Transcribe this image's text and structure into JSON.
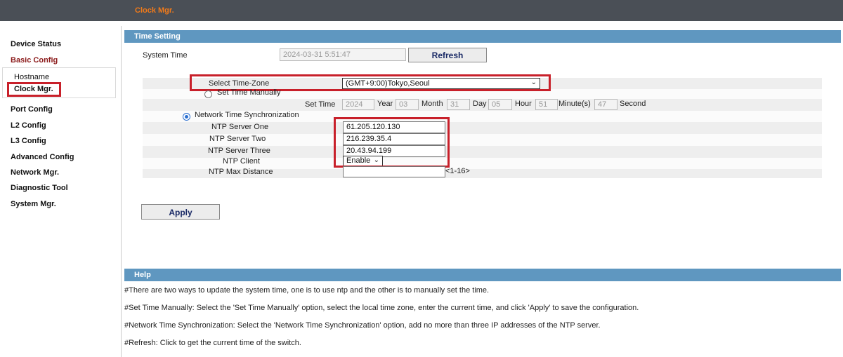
{
  "header": {
    "breadcrumb": "Clock Mgr."
  },
  "sidebar": {
    "items": [
      {
        "label": "Device Status"
      },
      {
        "label": "Basic Config"
      },
      {
        "label": "Port Config"
      },
      {
        "label": "L2 Config"
      },
      {
        "label": "L3 Config"
      },
      {
        "label": "Advanced Config"
      },
      {
        "label": "Network Mgr."
      },
      {
        "label": "Diagnostic Tool"
      },
      {
        "label": "System Mgr."
      }
    ],
    "sub_items": [
      {
        "label": "Hostname"
      },
      {
        "label": "Clock Mgr."
      }
    ]
  },
  "time_setting": {
    "section_title": "Time Setting",
    "system_time_label": "System Time",
    "system_time_value": "2024-03-31 5:51:47",
    "refresh_label": "Refresh",
    "timezone_label": "Select Time-Zone",
    "timezone_value": "(GMT+9:00)Tokyo,Seoul",
    "set_manually_label": "Set Time Manually",
    "set_time_label": "Set Time",
    "year_value": "2024",
    "year_label": "Year",
    "month_value": "03",
    "month_label": "Month",
    "day_value": "31",
    "day_label": "Day",
    "hour_value": "05",
    "hour_label": "Hour",
    "minute_value": "51",
    "minute_label": "Minute(s)",
    "second_value": "47",
    "second_label": "Second",
    "ntp_sync_label": "Network Time Synchronization",
    "ntp_one_label": "NTP Server One",
    "ntp_one_value": "61.205.120.130",
    "ntp_two_label": "NTP Server Two",
    "ntp_two_value": "216.239.35.4",
    "ntp_three_label": "NTP Server Three",
    "ntp_three_value": "20.43.94.199",
    "ntp_client_label": "NTP Client",
    "ntp_client_value": "Enable",
    "ntp_max_distance_label": "NTP Max Distance",
    "ntp_max_distance_value": "",
    "ntp_max_distance_hint": "<1-16>",
    "apply_label": "Apply"
  },
  "help": {
    "section_title": "Help",
    "lines": [
      "#There are two ways to update the system time, one is to use ntp and the other is to manually set the time.",
      "#Set Time Manually: Select the 'Set Time Manually' option, select the local time zone, enter the current time, and click 'Apply' to save the configuration.",
      "#Network Time Synchronization: Select the 'Network Time Synchronization' option, add no more than three IP addresses of the NTP server.",
      "#Refresh: Click to get the current time of the switch."
    ]
  },
  "colors": {
    "header_bg": "#4a4f56",
    "breadcrumb": "#f07a1a",
    "section_bar": "#5f97c0",
    "active_nav": "#8b1a1a",
    "highlight": "#c8202a"
  }
}
